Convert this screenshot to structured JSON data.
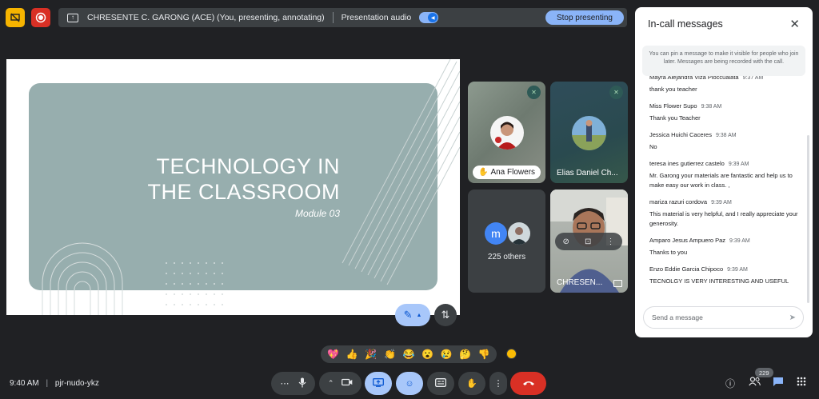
{
  "top": {
    "presenter_text": "CHRESENTE C. GARONG (ACE) (You, presenting, annotating)",
    "audio_label": "Presentation audio",
    "stop_label": "Stop presenting"
  },
  "slide": {
    "title_line1": "TECHNOLOGY IN",
    "title_line2": "THE CLASSROOM",
    "subtitle": "Module 03"
  },
  "tiles": {
    "ana": "Ana Flowers",
    "elias": "Elias Daniel Ch...",
    "others_initial": "m",
    "others": "225 others",
    "self": "CHRESEN..."
  },
  "chat": {
    "title": "In-call messages",
    "note": "You can pin a message to make it visible for people who join later. Messages are being recorded with the call.",
    "placeholder": "Send a message",
    "messages": [
      {
        "sender": "Mayra Alejandra Viza Pioccualata",
        "time": "9:37 AM",
        "text": "thank you teacher"
      },
      {
        "sender": "Miss Flower Supo",
        "time": "9:38 AM",
        "text": "Thank you Teacher"
      },
      {
        "sender": "Jessica Huichi Caceres",
        "time": "9:38 AM",
        "text": "No"
      },
      {
        "sender": "teresa ines gutierrez castelo",
        "time": "9:39 AM",
        "text": "Mr. Garong your materials are fantastic and help us to make easy our work in class. ,"
      },
      {
        "sender": "mariza razuri cordova",
        "time": "9:39 AM",
        "text": "This material is very   helpful, and I really appreciate your generosity."
      },
      {
        "sender": "Amparo Jesus Ampuero Paz",
        "time": "9:39 AM",
        "text": "Thanks to you"
      },
      {
        "sender": "Enzo Eddie Garcia Chipoco",
        "time": "9:39 AM",
        "text": "TECNOLGY IS VERY INTERESTING AND USEFUL"
      }
    ]
  },
  "reactions": [
    "💖",
    "👍",
    "🎉",
    "👏",
    "😂",
    "😮",
    "😢",
    "🤔",
    "👎"
  ],
  "bottom": {
    "time": "9:40 AM",
    "separator": "|",
    "meeting_code": "pjr-nudo-ykz",
    "people_count": "229"
  },
  "colors": {
    "accent": "#a8c7fa",
    "end_call": "#d93025",
    "slide_panel": "#97aeae"
  }
}
